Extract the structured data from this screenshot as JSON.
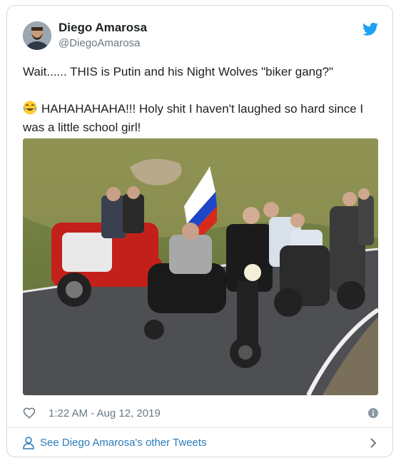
{
  "author": {
    "name": "Diego Amarosa",
    "handle": "@DiegoAmarosa"
  },
  "tweet": {
    "line1": "Wait...... THIS is Putin and his Night Wolves \"biker gang?\"",
    "line2": "HAHAHAHAHA!!! Holy shit I haven't laughed so hard since I was a little school girl!",
    "emoji": "laughing-crying-emoji"
  },
  "meta": {
    "timestamp": "1:22 AM - Aug 12, 2019"
  },
  "footer": {
    "link_label": "See Diego Amarosa's other Tweets"
  },
  "colors": {
    "brand": "#1da1f2",
    "link": "#2b7bb9",
    "muted": "#697882",
    "border": "#cfd9de"
  }
}
